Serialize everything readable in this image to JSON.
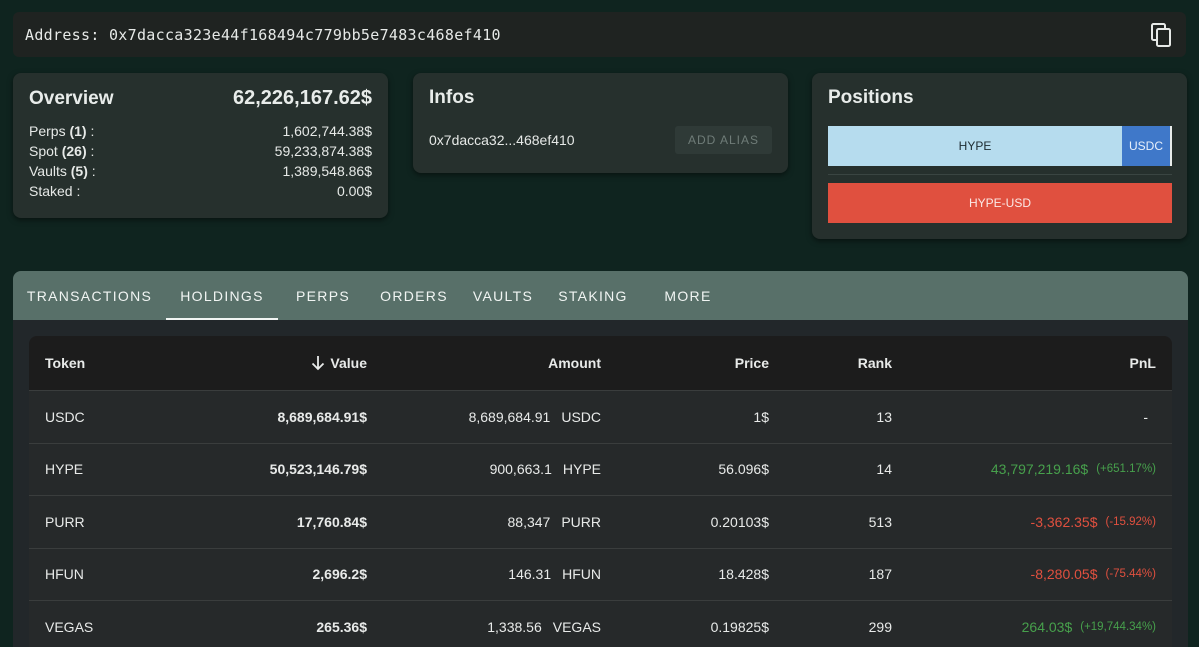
{
  "address_bar": {
    "label": "Address: 0x7dacca323e44f168494c779bb5e7483c468ef410",
    "copy_icon": "copy-icon"
  },
  "overview": {
    "title": "Overview",
    "total": "62,226,167.62$",
    "rows": [
      {
        "label": "Perps",
        "count": "(1)",
        "suffix": " :",
        "value": "1,602,744.38$"
      },
      {
        "label": "Spot",
        "count": "(26)",
        "suffix": " :",
        "value": "59,233,874.38$"
      },
      {
        "label": "Vaults",
        "count": "(5)",
        "suffix": " :",
        "value": "1,389,548.86$"
      },
      {
        "label": "Staked :",
        "count": "",
        "suffix": "",
        "value": "0.00$"
      }
    ]
  },
  "infos": {
    "title": "Infos",
    "address_short": "0x7dacca32...468ef410",
    "alias_button": "ADD ALIAS"
  },
  "positions": {
    "title": "Positions",
    "bar1": {
      "main": "HYPE",
      "secondary": "USDC"
    },
    "bar2": "HYPE-USD",
    "colors": {
      "hype": "#b6dcee",
      "usdc": "#3f78c9",
      "hype_usd": "#e0503f"
    }
  },
  "tabs": [
    {
      "label": "TRANSACTIONS",
      "active": false
    },
    {
      "label": "HOLDINGS",
      "active": true
    },
    {
      "label": "PERPS",
      "active": false
    },
    {
      "label": "ORDERS",
      "active": false
    },
    {
      "label": "VAULTS",
      "active": false
    },
    {
      "label": "STAKING",
      "active": false
    },
    {
      "label": "MORE",
      "active": false
    }
  ],
  "table": {
    "headers": {
      "token": "Token",
      "value": "Value",
      "amount": "Amount",
      "price": "Price",
      "rank": "Rank",
      "pnl": "PnL"
    },
    "sort_icon": "arrow-down-icon",
    "rows": [
      {
        "token": "USDC",
        "value": "8,689,684.91$",
        "amount": "8,689,684.91",
        "symbol": "USDC",
        "price": "1$",
        "rank": "13",
        "pnl": "-",
        "pnl_pct": "",
        "pnl_sign": "none"
      },
      {
        "token": "HYPE",
        "value": "50,523,146.79$",
        "amount": "900,663.1",
        "symbol": "HYPE",
        "price": "56.096$",
        "rank": "14",
        "pnl": "43,797,219.16$",
        "pnl_pct": "(+651.17%)",
        "pnl_sign": "pos"
      },
      {
        "token": "PURR",
        "value": "17,760.84$",
        "amount": "88,347",
        "symbol": "PURR",
        "price": "0.20103$",
        "rank": "513",
        "pnl": "-3,362.35$",
        "pnl_pct": "(-15.92%)",
        "pnl_sign": "neg"
      },
      {
        "token": "HFUN",
        "value": "2,696.2$",
        "amount": "146.31",
        "symbol": "HFUN",
        "price": "18.428$",
        "rank": "187",
        "pnl": "-8,280.05$",
        "pnl_pct": "(-75.44%)",
        "pnl_sign": "neg"
      },
      {
        "token": "VEGAS",
        "value": "265.36$",
        "amount": "1,338.56",
        "symbol": "VEGAS",
        "price": "0.19825$",
        "rank": "299",
        "pnl": "264.03$",
        "pnl_pct": "(+19,744.34%)",
        "pnl_sign": "pos"
      }
    ]
  }
}
